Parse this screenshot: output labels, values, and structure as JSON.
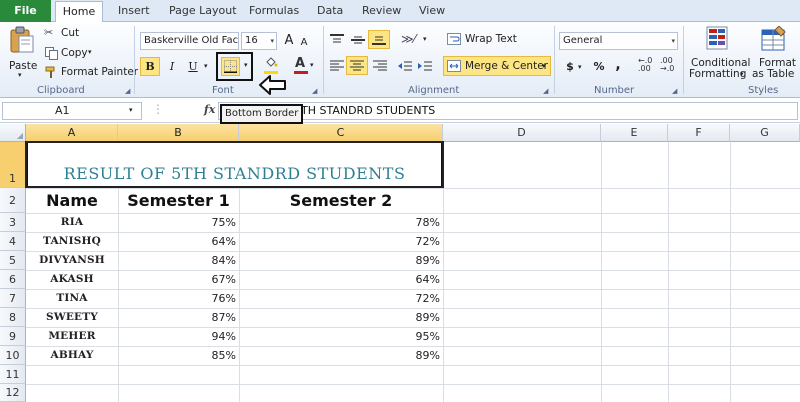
{
  "tabs": {
    "file": "File",
    "home": "Home",
    "insert": "Insert",
    "page_layout": "Page Layout",
    "formulas": "Formulas",
    "data": "Data",
    "review": "Review",
    "view": "View"
  },
  "clipboard": {
    "paste": "Paste",
    "cut": "Cut",
    "copy": "Copy",
    "format_painter": "Format Painter",
    "group": "Clipboard"
  },
  "font": {
    "name": "Baskerville Old Fac",
    "size": "16",
    "bold": "B",
    "italic": "I",
    "underline": "U",
    "font_color_letter": "A",
    "grow": "A",
    "shrink": "A",
    "group": "Font"
  },
  "alignment": {
    "wrap_text": "Wrap Text",
    "merge_center": "Merge & Center",
    "group": "Alignment"
  },
  "number": {
    "format": "General",
    "currency": "$",
    "percent": "%",
    "comma": ",",
    "group": "Number"
  },
  "styles": {
    "conditional": "Conditional",
    "conditional2": "Formatting",
    "format_as": "Format",
    "format_as2": "as Table",
    "group": "Styles"
  },
  "formula_bar": {
    "name_box": "A1",
    "fx": "fx",
    "content": "TH STANDRD STUDENTS"
  },
  "tooltip": "Bottom Border",
  "columns": [
    "A",
    "B",
    "C",
    "D",
    "E",
    "F",
    "G"
  ],
  "rows": [
    "1",
    "2",
    "3",
    "4",
    "5",
    "6",
    "7",
    "8",
    "9",
    "10",
    "11",
    "12"
  ],
  "sheet": {
    "title": "RESULT OF 5TH STANDRD STUDENTS",
    "headers": [
      "Name",
      "Semester 1",
      "Semester 2"
    ],
    "records": [
      {
        "name": "RIA",
        "sem1": "75%",
        "sem2": "78%"
      },
      {
        "name": "TANISHQ",
        "sem1": "64%",
        "sem2": "72%"
      },
      {
        "name": "DIVYANSH",
        "sem1": "84%",
        "sem2": "89%"
      },
      {
        "name": "AKASH",
        "sem1": "67%",
        "sem2": "64%"
      },
      {
        "name": "TINA",
        "sem1": "76%",
        "sem2": "72%"
      },
      {
        "name": "SWEETY",
        "sem1": "87%",
        "sem2": "89%"
      },
      {
        "name": "MEHER",
        "sem1": "94%",
        "sem2": "95%"
      },
      {
        "name": "ABHAY",
        "sem1": "85%",
        "sem2": "89%"
      }
    ]
  },
  "colors": {
    "file_tab": "#2a8a3c",
    "title_text": "#2f7f93",
    "selected_header": "#f7cf6e",
    "active_button": "#fde583"
  }
}
